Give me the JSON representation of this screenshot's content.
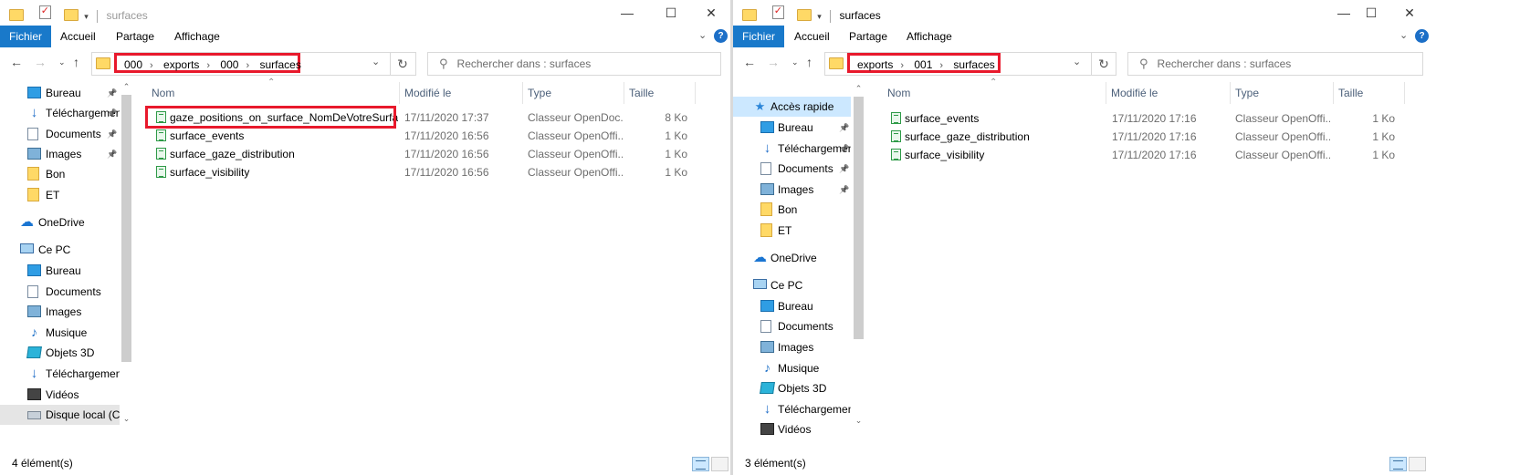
{
  "left": {
    "title": "surfaces",
    "ribbon": {
      "file": "Fichier",
      "home": "Accueil",
      "share": "Partage",
      "view": "Affichage",
      "help": "?"
    },
    "breadcrumb": [
      "000",
      "exports",
      "000",
      "surfaces"
    ],
    "search_placeholder": "Rechercher dans : surfaces",
    "nav": [
      {
        "label": "Bureau",
        "icon": "desktop-icon",
        "pinned": true
      },
      {
        "label": "Téléchargements",
        "icon": "download-icon",
        "pinned": true
      },
      {
        "label": "Documents",
        "icon": "documents-icon",
        "pinned": true
      },
      {
        "label": "Images",
        "icon": "images-icon",
        "pinned": true
      },
      {
        "label": "Bon",
        "icon": "folder-icon",
        "pinned": false
      },
      {
        "label": "ET",
        "icon": "folder-icon",
        "pinned": false
      },
      {
        "label": "OneDrive",
        "icon": "onedrive-icon",
        "pinned": false
      },
      {
        "label": "Ce PC",
        "icon": "pc-icon",
        "pinned": false
      },
      {
        "label": "Bureau",
        "icon": "desktop-icon",
        "pinned": false
      },
      {
        "label": "Documents",
        "icon": "documents-icon",
        "pinned": false
      },
      {
        "label": "Images",
        "icon": "images-icon",
        "pinned": false
      },
      {
        "label": "Musique",
        "icon": "music-icon",
        "pinned": false
      },
      {
        "label": "Objets 3D",
        "icon": "objects-3d-icon",
        "pinned": false
      },
      {
        "label": "Téléchargements",
        "icon": "download-icon",
        "pinned": false
      },
      {
        "label": "Vidéos",
        "icon": "videos-icon",
        "pinned": false
      },
      {
        "label": "Disque local (C:)",
        "icon": "disk-icon",
        "pinned": false
      }
    ],
    "columns": {
      "name": "Nom",
      "modified": "Modifié le",
      "type": "Type",
      "size": "Taille"
    },
    "files": [
      {
        "name": "gaze_positions_on_surface_NomDeVotreSurface",
        "modified": "17/11/2020 17:37",
        "type": "Classeur OpenDoc...",
        "size": "8 Ko"
      },
      {
        "name": "surface_events",
        "modified": "17/11/2020 16:56",
        "type": "Classeur OpenOffi...",
        "size": "1 Ko"
      },
      {
        "name": "surface_gaze_distribution",
        "modified": "17/11/2020 16:56",
        "type": "Classeur OpenOffi...",
        "size": "1 Ko"
      },
      {
        "name": "surface_visibility",
        "modified": "17/11/2020 16:56",
        "type": "Classeur OpenOffi...",
        "size": "1 Ko"
      }
    ],
    "status": "4 élément(s)"
  },
  "right": {
    "title": "surfaces",
    "ribbon": {
      "file": "Fichier",
      "home": "Accueil",
      "share": "Partage",
      "view": "Affichage",
      "help": "?"
    },
    "breadcrumb": [
      "exports",
      "001",
      "surfaces"
    ],
    "search_placeholder": "Rechercher dans : surfaces",
    "nav": [
      {
        "label": "Accès rapide",
        "icon": "quick-access-icon",
        "pinned": false
      },
      {
        "label": "Bureau",
        "icon": "desktop-icon",
        "pinned": true
      },
      {
        "label": "Téléchargements",
        "icon": "download-icon",
        "pinned": true
      },
      {
        "label": "Documents",
        "icon": "documents-icon",
        "pinned": true
      },
      {
        "label": "Images",
        "icon": "images-icon",
        "pinned": true
      },
      {
        "label": "Bon",
        "icon": "folder-icon",
        "pinned": false
      },
      {
        "label": "ET",
        "icon": "folder-icon",
        "pinned": false
      },
      {
        "label": "OneDrive",
        "icon": "onedrive-icon",
        "pinned": false
      },
      {
        "label": "Ce PC",
        "icon": "pc-icon",
        "pinned": false
      },
      {
        "label": "Bureau",
        "icon": "desktop-icon",
        "pinned": false
      },
      {
        "label": "Documents",
        "icon": "documents-icon",
        "pinned": false
      },
      {
        "label": "Images",
        "icon": "images-icon",
        "pinned": false
      },
      {
        "label": "Musique",
        "icon": "music-icon",
        "pinned": false
      },
      {
        "label": "Objets 3D",
        "icon": "objects-3d-icon",
        "pinned": false
      },
      {
        "label": "Téléchargements",
        "icon": "download-icon",
        "pinned": false
      },
      {
        "label": "Vidéos",
        "icon": "videos-icon",
        "pinned": false
      }
    ],
    "columns": {
      "name": "Nom",
      "modified": "Modifié le",
      "type": "Type",
      "size": "Taille"
    },
    "files": [
      {
        "name": "surface_events",
        "modified": "17/11/2020 17:16",
        "type": "Classeur OpenOffi...",
        "size": "1 Ko"
      },
      {
        "name": "surface_gaze_distribution",
        "modified": "17/11/2020 17:16",
        "type": "Classeur OpenOffi...",
        "size": "1 Ko"
      },
      {
        "name": "surface_visibility",
        "modified": "17/11/2020 17:16",
        "type": "Classeur OpenOffi...",
        "size": "1 Ko"
      }
    ],
    "status": "3 élément(s)"
  },
  "colors": {
    "accent": "#1979ca",
    "highlight_box": "#e8192c",
    "selected": "#cce8ff"
  }
}
